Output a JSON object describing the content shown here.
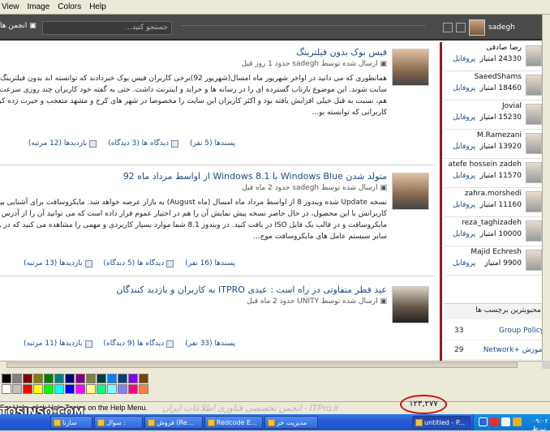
{
  "menubar": {
    "items": [
      "View",
      "Image",
      "Colors",
      "Help"
    ]
  },
  "topbar": {
    "left_label": "انجمن ها",
    "search_placeholder": "جستجو کنید...",
    "search_button": "fl",
    "username": "sadegh"
  },
  "posts": [
    {
      "title": "فیس بوک بدون فیلترینگ",
      "meta": "ارسال شده توسط sadegh حدود 1 روز قبل",
      "body": "همانطوری که می دانید در اواخر شهریور ماه امسال(شهریور 92)برخی کاربران فیس بوک خبردادند که توانسته اند بدون فیلترینگ وارد این سایت شوند. این موضوع بازتاب گسترده ای را در رسانه ها و جراید و اینترنت داشت. حتی به گفته خود کاربران چند روزی سرعت فیس بوک هم، نسبت به قبل خیلی افزایش یافته بود و اکثر کاربران این سایت را مخصوصا در شهر های کرج و مشهد متعجب و حیرت زده کرده بود. کاربرانی که توانسته بو...",
      "likes": "پسندها (5 نفر)",
      "comments": "دیدگاه ها (3 دیدگاه)",
      "visits": "بازدیدها (12 مرتبه)"
    },
    {
      "title": "متولد شدن Windows Blue با Windows 8.1 از اواسط مرداد ماه 92",
      "meta": "ارسال شده توسط sadegh حدود 2 ماه قبل",
      "body": "نسخه Update شده ویندوز 8 از اواسط مرداد ماه امسال (ماه August) به بازار عرضه خواهد شد. مایکروسافت برای آشنایی بیشتر کاربرانش با این محصول، در حال حاضر نسخه پیش نمایش آن را هم در اختیار عموم قرار داده است که می توانید آن را از آدرس سایت مایکروسافت و در قالب یک فایل ISO در یافت کنید. در ویندوز 8.1 شما موارد بسیار کاربردی و مهمی را مشاهده می کنید که در ویندوز 8 و سایر سیستم عامل های مایکروسافت موج...",
      "likes": "پسندها (16 نفر)",
      "comments": "دیدگاه ها (5 دیدگاه)",
      "visits": "بازدیدها (13 مرتبه)"
    },
    {
      "title": "عید فطر متفاوتی در راه است : عیدی ITPRO به کاربران و بازدید کنندگان",
      "meta": "ارسال شده توسط UNITY حدود 2 ماه قبل",
      "body": "",
      "likes": "پسندها (33 نفر)",
      "comments": "دیدگاه ها (9 دیدگاه)",
      "visits": "بازدیدها (11 مرتبه)"
    }
  ],
  "sidebar": {
    "profile_label": "پروفایل",
    "users": [
      {
        "name": "رضا صادقی",
        "points": "24330 امتیاز"
      },
      {
        "name": "SaeedShams",
        "points": "18460 امتیاز"
      },
      {
        "name": "Jovial",
        "points": "15230 امتیاز"
      },
      {
        "name": "M.Ramezani",
        "points": "13920 امتیاز"
      },
      {
        "name": "atefe hossein zadeh",
        "points": "11570 امتیاز"
      },
      {
        "name": "zahra.morshedi",
        "points": "11160 امتیاز"
      },
      {
        "name": "reza_taghizadeh",
        "points": "10000 امتیاز"
      },
      {
        "name": "Majid Echresh",
        "points": "9900 امتیاز"
      }
    ],
    "tags_title": "محبوبترین برچسب ها",
    "tags": [
      {
        "name": "Group Policy",
        "count": "33"
      },
      {
        "name": "Network+ آموزش",
        "count": "29"
      }
    ]
  },
  "status": {
    "help": "For Help, click Help Topics on the Help Menu.",
    "watermark": "ITPro.ir - انجمن تخصصی فناوری اطلاعات ایران",
    "circled_number": "۱۲۳,۲۷۷",
    "site": "TOSINSO.COM"
  },
  "taskbar": {
    "tasks": [
      "سازنا",
      "سوال :",
      "فروش (Re...",
      "Redcode E...",
      "مدیریت خر",
      "untitled - P..."
    ],
    "clock": "۰۹:۰۲ ب.ظ"
  },
  "colors": {
    "accent": "#a01818",
    "link": "#1a4b8c",
    "topbar": "#4a4a4a"
  },
  "palette_colors": [
    "#000000",
    "#808080",
    "#800000",
    "#808000",
    "#008000",
    "#008080",
    "#000080",
    "#800080",
    "#808040",
    "#004040",
    "#0080ff",
    "#004080",
    "#8000ff",
    "#804000",
    "#ffffff",
    "#c0c0c0",
    "#ff0000",
    "#ffff00",
    "#00ff00",
    "#00ffff",
    "#0000ff",
    "#ff00ff",
    "#ffff80",
    "#00ff80",
    "#80ffff",
    "#8080ff",
    "#ff0080",
    "#ff8040"
  ]
}
